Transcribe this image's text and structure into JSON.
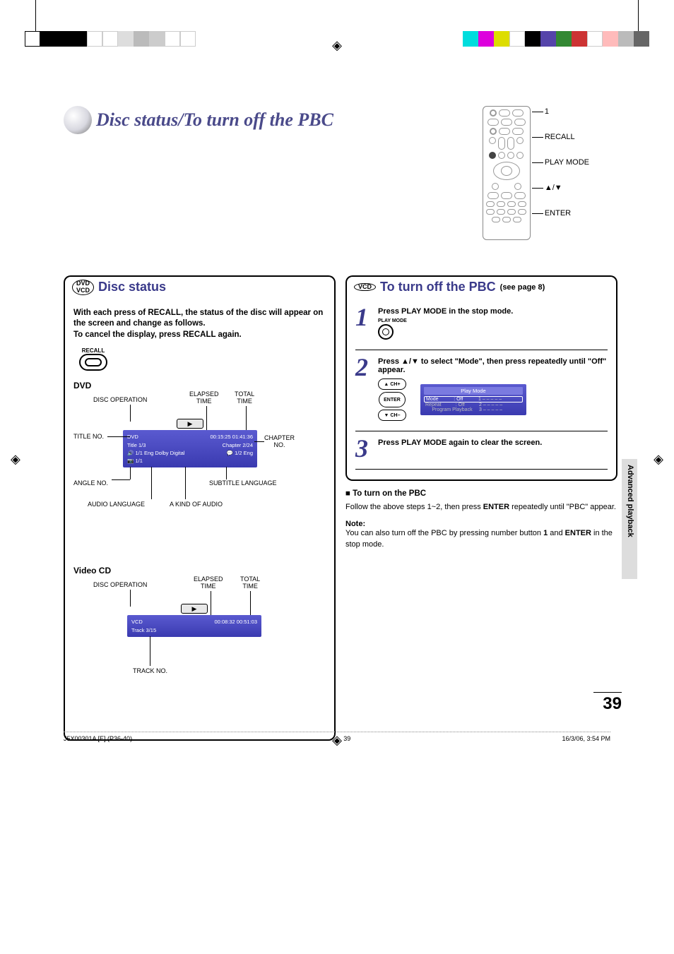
{
  "page_title": "Disc status/To turn off the PBC",
  "remote_labels": [
    "1",
    "RECALL",
    "PLAY MODE",
    "▲/▼",
    "ENTER"
  ],
  "section_disc_status": {
    "badge_lines": [
      "DVD",
      "VCD"
    ],
    "title": "Disc status",
    "intro": "With each press of RECALL, the status of the disc will appear on the screen and change as follows.",
    "intro2": "To cancel the display, press RECALL again.",
    "recall_label": "RECALL",
    "dvd_heading": "DVD",
    "dvd_callouts": {
      "disc_operation": "DISC OPERATION",
      "elapsed": "ELAPSED\nTIME",
      "total": "TOTAL\nTIME",
      "title_no": "TITLE NO.",
      "chapter_no": "CHAPTER\nNO.",
      "angle_no": "ANGLE NO.",
      "subtitle_lang": "SUBTITLE LANGUAGE",
      "audio_lang": "AUDIO LANGUAGE",
      "audio_kind": "A KIND OF AUDIO"
    },
    "dvd_osd": {
      "type_row_left": "DVD",
      "type_row_right": "00:15:25   01:41:36",
      "title_row_left": "Title  1/3",
      "title_row_right": "Chapter 2/24",
      "audio_row_left": "1/1 Eng Dolby Digital",
      "audio_row_right": "1/2 Eng",
      "angle_row": "1/1"
    },
    "vcd_heading": "Video CD",
    "vcd_callouts": {
      "disc_operation": "DISC OPERATION",
      "elapsed": "ELAPSED\nTIME",
      "total": "TOTAL\nTIME",
      "track_no": "TRACK NO."
    },
    "vcd_osd": {
      "left": "VCD",
      "right": "00:08:32   00:51:03",
      "track": "Track  3/15"
    }
  },
  "section_pbc": {
    "badge": "VCD",
    "title": "To turn off the PBC",
    "subtitle": "(see page 8)",
    "steps": [
      {
        "num": "1",
        "text": "Press PLAY MODE in the stop mode.",
        "play_mode_label": "PLAY MODE"
      },
      {
        "num": "2",
        "text_pre": "Press ",
        "arrows": "▲/▼",
        "text_mid": " to select \"Mode\", then press ",
        "enter": "ENTER",
        "text_post": " repeatedly until \"Off\" appear.",
        "dpad_up": "▲CH+",
        "dpad_enter": "ENTER",
        "dpad_down": "▼CH–",
        "osd_title": "Play Mode",
        "osd_rows": [
          {
            "l": "Mode",
            "m": ": Off",
            "r": "1   – – – – –"
          },
          {
            "l": "Repeat",
            "m": ": Off",
            "r": "2   – – – – –"
          },
          {
            "l": "",
            "m": "Program Playback",
            "r": "3   – – – – –"
          }
        ]
      },
      {
        "num": "3",
        "text": "Press PLAY MODE again to clear the screen."
      }
    ],
    "turn_on_title": "■ To turn on the PBC",
    "turn_on_text_pre": "Follow the above steps 1~2, then press ",
    "turn_on_enter": "ENTER",
    "turn_on_text_post": " repeatedly until \"PBC\" appear.",
    "note_label": "Note:",
    "note_text_pre": "You can also turn off the PBC by pressing number button ",
    "note_one": "1",
    "note_text_mid": " and ",
    "note_enter": "ENTER",
    "note_text_post": " in the stop mode."
  },
  "side_tab": "Advanced playback",
  "page_number": "39",
  "footer": {
    "left": "J5X00301A [E] (P36-40)",
    "center": "39",
    "right": "16/3/06, 3:54 PM"
  },
  "crop_colors_left": [
    "#fff",
    "#000",
    "#000",
    "#000",
    "#fff",
    "#fff",
    "#ddd",
    "#ddd",
    "#ddd",
    "#fff",
    "#fff"
  ],
  "crop_colors_right": [
    "#0ff",
    "#f0f",
    "#ff0",
    "#fff",
    "#000",
    "#66c",
    "#393",
    "#c33",
    "#fff",
    "#fbb",
    "#bbb",
    "#666"
  ]
}
